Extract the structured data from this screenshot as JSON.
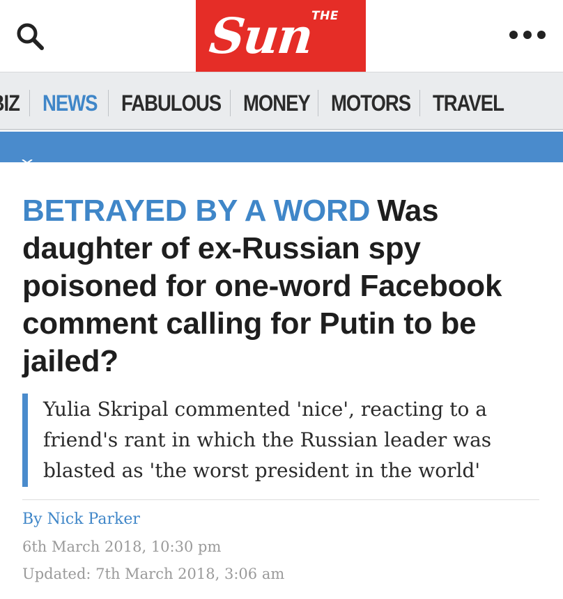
{
  "header": {
    "logo": {
      "the": "THE",
      "name": "Sun"
    },
    "search_icon": "search-icon",
    "menu_icon": "more-dots-icon",
    "brand_color": "#e52d27"
  },
  "nav": {
    "items": [
      {
        "label": "TV & SHOWBIZ"
      },
      {
        "label": "NEWS",
        "active": true
      },
      {
        "label": "FABULOUS"
      },
      {
        "label": "MONEY"
      },
      {
        "label": "MOTORS"
      },
      {
        "label": "TRAVEL"
      }
    ],
    "accent_color": "#3f86c8"
  },
  "article": {
    "kicker": "BETRAYED BY A WORD",
    "headline": "Was daughter of ex-Russian spy poisoned for one-word Facebook comment calling for Putin to be jailed?",
    "standfirst": "Yulia Skripal commented 'nice', reacting to a friend's rant in which the Russian leader was blasted as 'the worst president in the world'",
    "byline_prefix": "By",
    "author": "Nick Parker",
    "published": "6th March 2018, 10:30 pm",
    "updated": "Updated: 7th March 2018, 3:06 am"
  }
}
